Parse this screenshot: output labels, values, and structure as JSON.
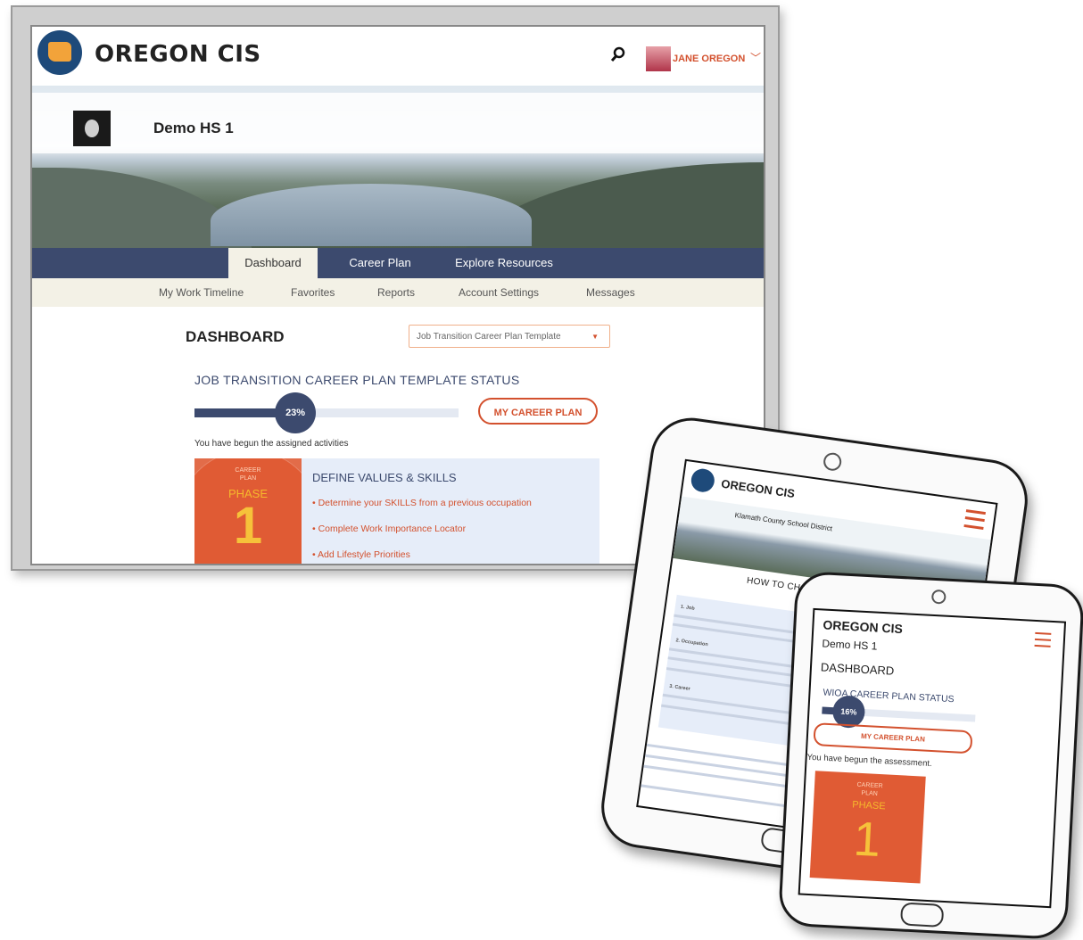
{
  "desktop": {
    "brand": "OREGON CIS",
    "user": "JANE OREGON",
    "school": "Demo HS 1",
    "tabs": [
      "Dashboard",
      "Career Plan",
      "Explore Resources"
    ],
    "subnav": [
      "My Work Timeline",
      "Favorites",
      "Reports",
      "Account Settings",
      "Messages"
    ],
    "dashboard_title": "DASHBOARD",
    "plan_select": "Job Transition Career Plan Template",
    "status_title": "JOB TRANSITION CAREER PLAN TEMPLATE STATUS",
    "progress": "23%",
    "progress_fraction": 0.23,
    "career_plan_button": "MY CAREER PLAN",
    "begun_text": "You have begun the assigned activities",
    "phase": {
      "label1": "CAREER",
      "label2": "PLAN",
      "phase": "PHASE",
      "number": "1"
    },
    "define_title": "DEFINE VALUES & SKILLS",
    "activities": [
      "Determine your SKILLS from a previous occupation",
      "Complete Work Importance Locator",
      "Add Lifestyle Priorities"
    ]
  },
  "phone1": {
    "brand": "OREGON CIS",
    "district": "Klamath County School District",
    "heading": "HOW TO CHOOSE AN OCCUPATION",
    "items": [
      "1. Job",
      "2. Occupation",
      "3. Career"
    ]
  },
  "phone2": {
    "brand": "OREGON CIS",
    "school": "Demo HS 1",
    "dashboard_title": "DASHBOARD",
    "status_title": "WIOA CAREER PLAN STATUS",
    "progress": "16%",
    "progress_fraction": 0.16,
    "career_plan_button": "MY CAREER PLAN",
    "begun_text": "You have begun the assessment.",
    "phase": {
      "label1": "CAREER",
      "label2": "PLAN",
      "phase": "PHASE",
      "number": "1"
    }
  },
  "colors": {
    "navy": "#3c4a6e",
    "accent": "#d3512e",
    "phase_bg": "#e05b34",
    "gold": "#f6c23a"
  },
  "icons": [
    "search-icon",
    "chevron-down-icon",
    "hamburger-menu-icon"
  ]
}
